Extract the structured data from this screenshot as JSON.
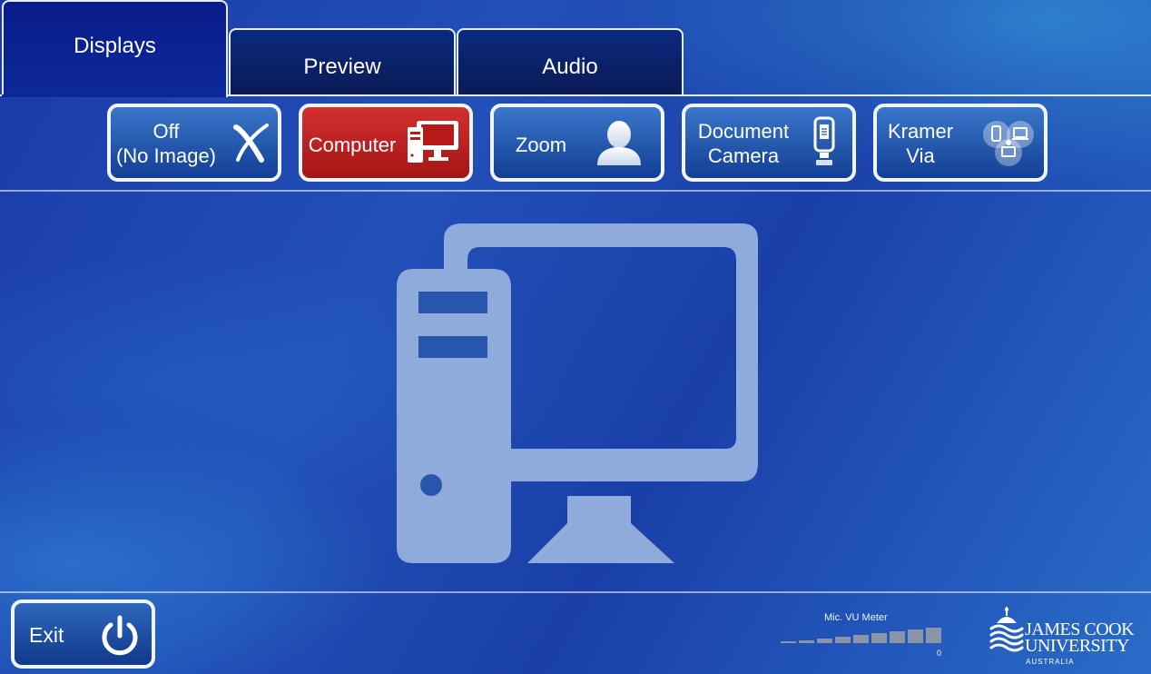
{
  "tabs": [
    {
      "label": "Displays",
      "active": true
    },
    {
      "label": "Preview",
      "active": false
    },
    {
      "label": "Audio",
      "active": false
    }
  ],
  "sources": [
    {
      "line1": "Off",
      "line2": "(No Image)",
      "icon": "no-image-icon",
      "selected": false
    },
    {
      "line1": "Computer",
      "line2": "",
      "icon": "computer-icon",
      "selected": true
    },
    {
      "line1": "Zoom",
      "line2": "",
      "icon": "user-icon",
      "selected": false
    },
    {
      "line1": "Document",
      "line2": "Camera",
      "icon": "document-camera-icon",
      "selected": false
    },
    {
      "line1": "Kramer",
      "line2": "Via",
      "icon": "kramer-via-icon",
      "selected": false
    }
  ],
  "main": {
    "icon": "computer-icon"
  },
  "footer": {
    "exit_label": "Exit",
    "vu_title": "Mic. VU Meter",
    "vu_zero": "0",
    "logo": {
      "line1": "JAMES COOK",
      "line2": "UNIVERSITY",
      "line3": "AUSTRALIA"
    }
  },
  "colors": {
    "selected": "#c21f1f",
    "button": "#2a60b5",
    "background": "#1e48b2"
  }
}
